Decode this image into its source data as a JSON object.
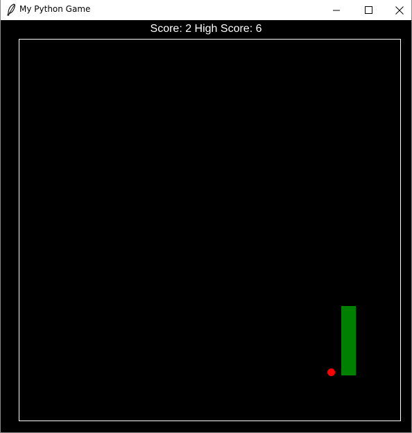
{
  "window": {
    "title": "My Python Game",
    "icon": "feather-icon"
  },
  "controls": {
    "minimize_icon": "minimize-icon",
    "maximize_icon": "maximize-icon",
    "close_icon": "close-icon"
  },
  "game": {
    "score_text": "Score: 2 High Score: 6",
    "score": 2,
    "high_score": 6,
    "background_color": "#000000",
    "border_color": "#ffffff",
    "snake_color": "#008000",
    "food_color": "#ff0000",
    "text_color": "#ffffff"
  }
}
